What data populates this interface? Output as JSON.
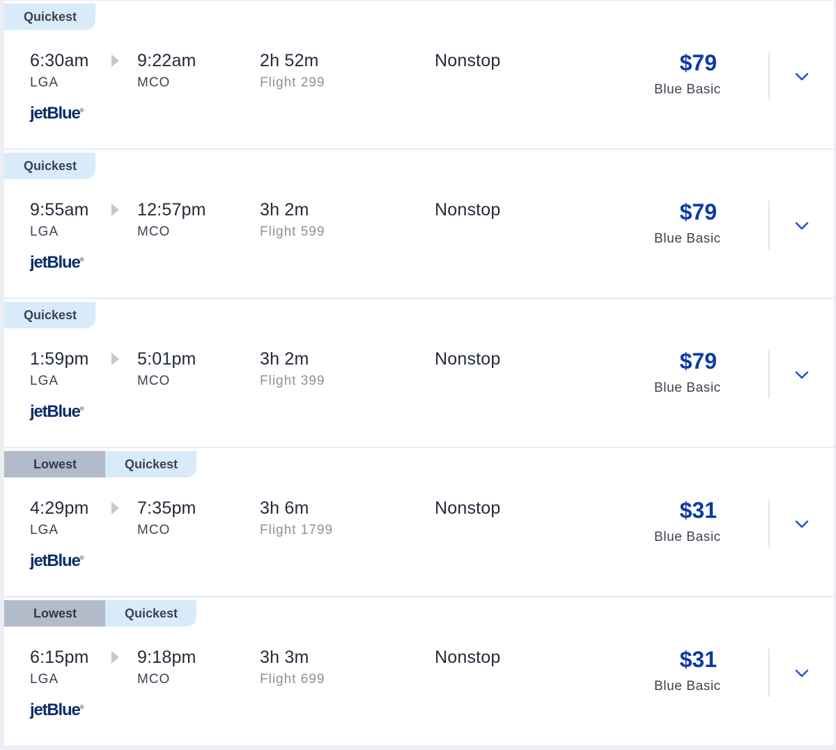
{
  "flights": [
    {
      "badges": [
        {
          "label": "Quickest",
          "kind": "quickest"
        }
      ],
      "depart_time": "6:30am",
      "depart_code": "LGA",
      "arrive_time": "9:22am",
      "arrive_code": "MCO",
      "duration": "2h 52m",
      "flight_number": "Flight 299",
      "stops": "Nonstop",
      "price": "$79",
      "fare": "Blue Basic",
      "airline": "jetBlue"
    },
    {
      "badges": [
        {
          "label": "Quickest",
          "kind": "quickest"
        }
      ],
      "depart_time": "9:55am",
      "depart_code": "LGA",
      "arrive_time": "12:57pm",
      "arrive_code": "MCO",
      "duration": "3h 2m",
      "flight_number": "Flight 599",
      "stops": "Nonstop",
      "price": "$79",
      "fare": "Blue Basic",
      "airline": "jetBlue"
    },
    {
      "badges": [
        {
          "label": "Quickest",
          "kind": "quickest"
        }
      ],
      "depart_time": "1:59pm",
      "depart_code": "LGA",
      "arrive_time": "5:01pm",
      "arrive_code": "MCO",
      "duration": "3h 2m",
      "flight_number": "Flight 399",
      "stops": "Nonstop",
      "price": "$79",
      "fare": "Blue Basic",
      "airline": "jetBlue"
    },
    {
      "badges": [
        {
          "label": "Lowest",
          "kind": "lowest"
        },
        {
          "label": "Quickest",
          "kind": "quickest"
        }
      ],
      "depart_time": "4:29pm",
      "depart_code": "LGA",
      "arrive_time": "7:35pm",
      "arrive_code": "MCO",
      "duration": "3h 6m",
      "flight_number": "Flight 1799",
      "stops": "Nonstop",
      "price": "$31",
      "fare": "Blue Basic",
      "airline": "jetBlue"
    },
    {
      "badges": [
        {
          "label": "Lowest",
          "kind": "lowest"
        },
        {
          "label": "Quickest",
          "kind": "quickest"
        }
      ],
      "depart_time": "6:15pm",
      "depart_code": "LGA",
      "arrive_time": "9:18pm",
      "arrive_code": "MCO",
      "duration": "3h 3m",
      "flight_number": "Flight 699",
      "stops": "Nonstop",
      "price": "$31",
      "fare": "Blue Basic",
      "airline": "jetBlue"
    }
  ],
  "colors": {
    "price": "#0d3aa8",
    "badge_quickest": "#d9ebf8",
    "badge_lowest": "#b1bbc9",
    "airline_logo": "#0c2d6b"
  },
  "icons": {
    "expand": "chevron-down-icon",
    "direction": "arrow-right-icon"
  }
}
